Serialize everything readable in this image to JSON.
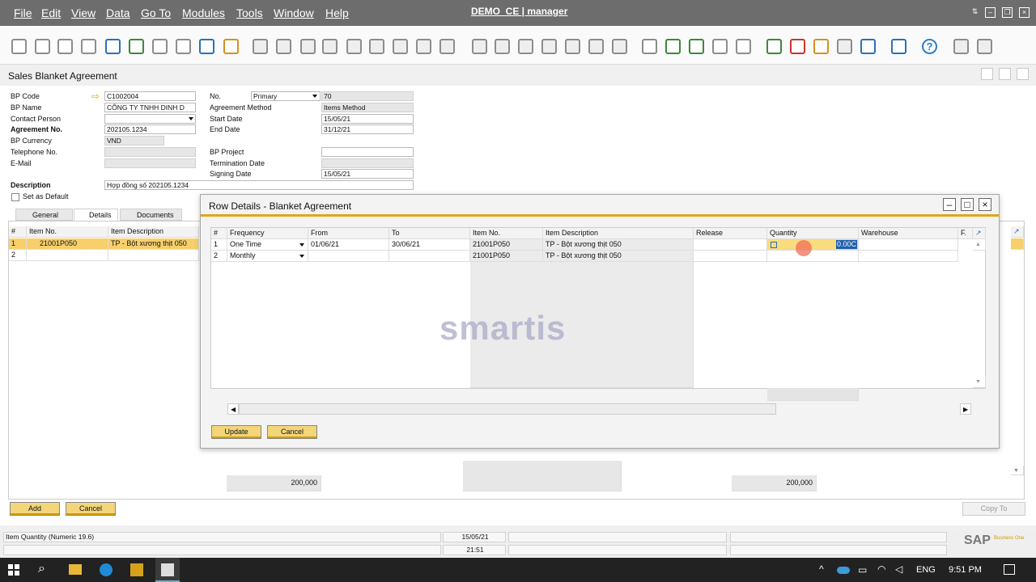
{
  "menu": {
    "items": [
      "File",
      "Edit",
      "View",
      "Data",
      "Go To",
      "Modules",
      "Tools",
      "Window",
      "Help"
    ],
    "title": "DEMO_CE | manager"
  },
  "window": {
    "title": "Sales Blanket Agreement"
  },
  "header": {
    "bp_code_label": "BP Code",
    "bp_code": "C1002004",
    "bp_name_label": "BP Name",
    "bp_name": "CÔNG TY TNHH DINH D",
    "contact_label": "Contact Person",
    "agreement_label": "Agreement No.",
    "agreement_no": "202105.1234",
    "currency_label": "BP Currency",
    "currency": "VND",
    "telephone_label": "Telephone No.",
    "email_label": "E-Mail",
    "no_label": "No.",
    "series": "Primary",
    "no": "70",
    "method_label": "Agreement Method",
    "method": "Items Method",
    "start_label": "Start Date",
    "start_date": "15/05/21",
    "end_label": "End Date",
    "end_date": "31/12/21",
    "project_label": "BP Project",
    "termination_label": "Termination Date",
    "signing_label": "Signing Date",
    "signing_date": "15/05/21",
    "description_label": "Description",
    "description": "Hợp đồng số 202105.1234",
    "default_label": "Set as Default"
  },
  "tabs": [
    "General",
    "Details",
    "Documents"
  ],
  "grid": {
    "columns": [
      "#",
      "Item No.",
      "Item Description"
    ],
    "rows": [
      {
        "n": "1",
        "item": "21001P050",
        "desc": "TP - Bột xương thịt 050"
      },
      {
        "n": "2",
        "item": "",
        "desc": ""
      }
    ],
    "totals": [
      "200,000",
      "200,000"
    ]
  },
  "dialog": {
    "title": "Row Details - Blanket Agreement",
    "columns": [
      "#",
      "Frequency",
      "From",
      "To",
      "Item No.",
      "Item Description",
      "Release",
      "Quantity",
      "Warehouse",
      "F."
    ],
    "rows": [
      {
        "n": "1",
        "freq": "One Time",
        "from": "01/06/21",
        "to": "30/06/21",
        "item": "21001P050",
        "desc": "TP - Bột xương thịt 050",
        "qty": "0.00C"
      },
      {
        "n": "2",
        "freq": "Monthly",
        "from": "",
        "to": "",
        "item": "21001P050",
        "desc": "TP - Bột xương thịt 050",
        "qty": ""
      }
    ],
    "update": "Update",
    "cancel": "Cancel"
  },
  "buttons": {
    "add": "Add",
    "cancel": "Cancel",
    "copy_to": "Copy To"
  },
  "status": {
    "message": "Item Quantity (Numeric 19.6)",
    "date": "15/05/21",
    "time": "21:51"
  },
  "brand": {
    "sap": "SAP",
    "sap_sub": "Business One",
    "watermark": "smartis"
  },
  "taskbar": {
    "lang": "ENG",
    "time": "9:51 PM"
  }
}
